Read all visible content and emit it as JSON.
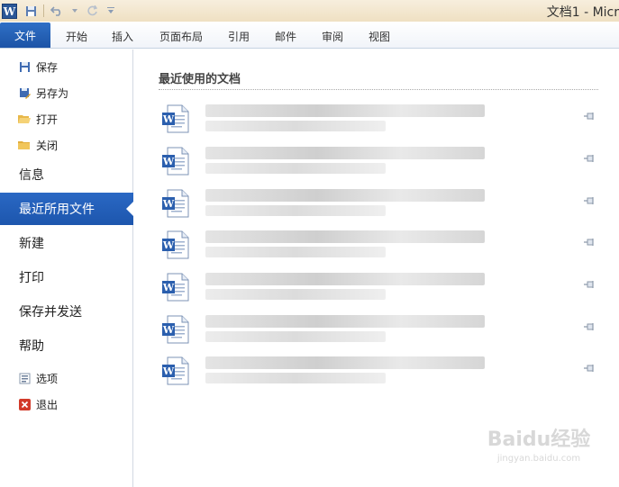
{
  "window": {
    "title": "文档1 - Micr",
    "app_icon_letter": "W"
  },
  "quick_access": {
    "save_icon": "save-icon",
    "undo_icon": "undo-icon",
    "redo_icon": "redo-icon",
    "customize_icon": "chevron-down-icon"
  },
  "ribbon": {
    "file_tab": "文件",
    "tabs": [
      "开始",
      "插入",
      "页面布局",
      "引用",
      "邮件",
      "审阅",
      "视图"
    ]
  },
  "backstage": {
    "commands": [
      {
        "label": "保存",
        "icon": "save-icon"
      },
      {
        "label": "另存为",
        "icon": "save-as-icon"
      },
      {
        "label": "打开",
        "icon": "folder-open-icon"
      },
      {
        "label": "关闭",
        "icon": "folder-close-icon"
      }
    ],
    "nav": [
      {
        "label": "信息",
        "selected": false
      },
      {
        "label": "最近所用文件",
        "selected": true
      },
      {
        "label": "新建",
        "selected": false
      },
      {
        "label": "打印",
        "selected": false
      },
      {
        "label": "保存并发送",
        "selected": false
      },
      {
        "label": "帮助",
        "selected": false
      }
    ],
    "bottom_commands": [
      {
        "label": "选项",
        "icon": "options-icon"
      },
      {
        "label": "退出",
        "icon": "exit-icon"
      }
    ]
  },
  "recent": {
    "title": "最近使用的文档",
    "documents": [
      {
        "name": "",
        "path": "",
        "pin_icon": "pin-icon"
      },
      {
        "name": "",
        "path": "",
        "pin_icon": "pin-icon"
      },
      {
        "name": "",
        "path": "",
        "pin_icon": "pin-icon"
      },
      {
        "name": "",
        "path": "",
        "pin_icon": "pin-icon"
      },
      {
        "name": "",
        "path": "",
        "pin_icon": "pin-icon"
      },
      {
        "name": "",
        "path": "",
        "pin_icon": "pin-icon"
      },
      {
        "name": "",
        "path": "",
        "pin_icon": "pin-icon"
      }
    ]
  },
  "watermark": {
    "logo": "Baidu经验",
    "url": "jingyan.baidu.com"
  },
  "colors": {
    "accent": "#1d56ad",
    "file_tab": "#2563b8",
    "title_bar": "#f3e6cc"
  }
}
